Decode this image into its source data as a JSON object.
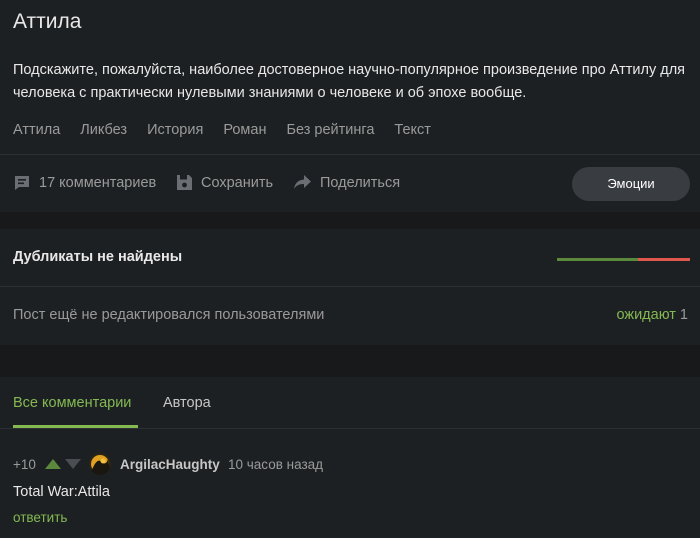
{
  "post": {
    "title": "Аттила",
    "text": "Подскажите, пожалуйста, наиболее достоверное научно-популярное произведение про Аттилу для человека с практически нулевыми знаниями о человеке и об эпохе вообще.",
    "tags": [
      "Аттила",
      "Ликбез",
      "История",
      "Роман",
      "Без рейтинга",
      "Текст"
    ]
  },
  "actions": {
    "comments_label": "17 комментариев",
    "save_label": "Сохранить",
    "share_label": "Поделиться",
    "emotions_label": "Эмоции"
  },
  "duplicates": {
    "title": "Дубликаты не найдены"
  },
  "edits": {
    "text": "Пост ещё не редактировался пользователями",
    "waiting_label": "ожидают",
    "waiting_count": "1"
  },
  "comments_tabs": {
    "all_label": "Все комментарии",
    "author_label": "Автора"
  },
  "comment": {
    "rating": "+10",
    "author": "ArgilacHaughty",
    "time": "10 часов назад",
    "text": "Total War:Attila",
    "reply_label": "ответить"
  },
  "icons": {
    "comments": "comment-icon",
    "save": "save-icon",
    "share": "share-icon",
    "vote_up": "arrow-up-icon",
    "vote_down": "arrow-down-icon"
  },
  "colors": {
    "accent_green": "#84b952",
    "bar_green": "#5c8a3c",
    "bar_red": "#e0584b",
    "background": "#1d2023"
  }
}
